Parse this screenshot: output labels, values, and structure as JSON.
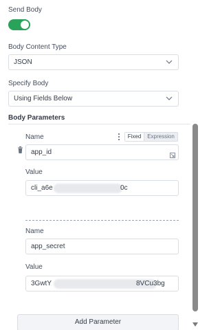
{
  "send_body": {
    "label": "Send Body",
    "enabled": true
  },
  "body_content_type": {
    "label": "Body Content Type",
    "value": "JSON"
  },
  "specify_body": {
    "label": "Specify Body",
    "value": "Using Fields Below"
  },
  "body_parameters": {
    "label": "Body Parameters",
    "mode_toggle": {
      "fixed": "Fixed",
      "expression": "Expression",
      "selected": "Fixed"
    },
    "params": [
      {
        "name_label": "Name",
        "name": "app_id",
        "value_label": "Value",
        "value_prefix": "cli_a6e",
        "value_suffix": "0c"
      },
      {
        "name_label": "Name",
        "name": "app_secret",
        "value_label": "Value",
        "value_prefix": "3GwtY",
        "value_suffix": "8VCu3bg"
      }
    ],
    "add_button": "Add Parameter"
  },
  "colors": {
    "toggle_on": "#29a35a",
    "scroll_thumb": "#8a8a8a"
  },
  "icons": [
    "chevron-down-icon",
    "trash-icon",
    "kebab-menu-icon",
    "expand-icon",
    "scroll-down-arrow-icon"
  ]
}
